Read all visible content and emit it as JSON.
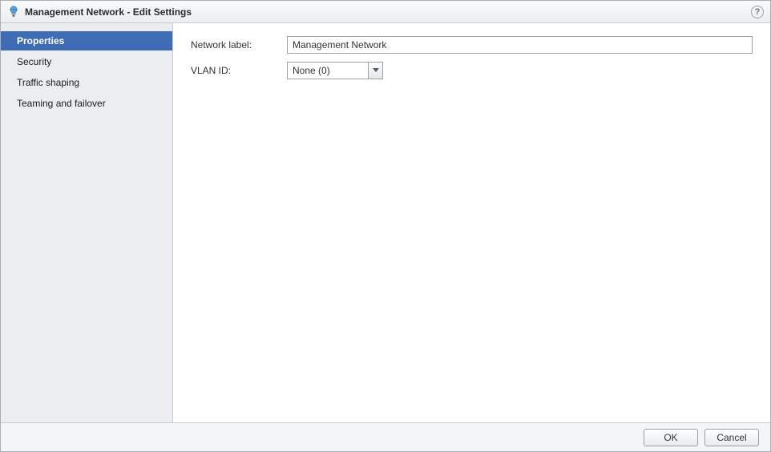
{
  "window": {
    "title": "Management Network - Edit Settings"
  },
  "sidebar": {
    "items": [
      {
        "label": "Properties",
        "selected": true
      },
      {
        "label": "Security",
        "selected": false
      },
      {
        "label": "Traffic shaping",
        "selected": false
      },
      {
        "label": "Teaming and failover",
        "selected": false
      }
    ]
  },
  "form": {
    "network_label": {
      "label": "Network label:",
      "value": "Management Network"
    },
    "vlan_id": {
      "label": "VLAN ID:",
      "selected": "None (0)"
    }
  },
  "footer": {
    "ok": "OK",
    "cancel": "Cancel"
  },
  "help_tooltip": "?"
}
